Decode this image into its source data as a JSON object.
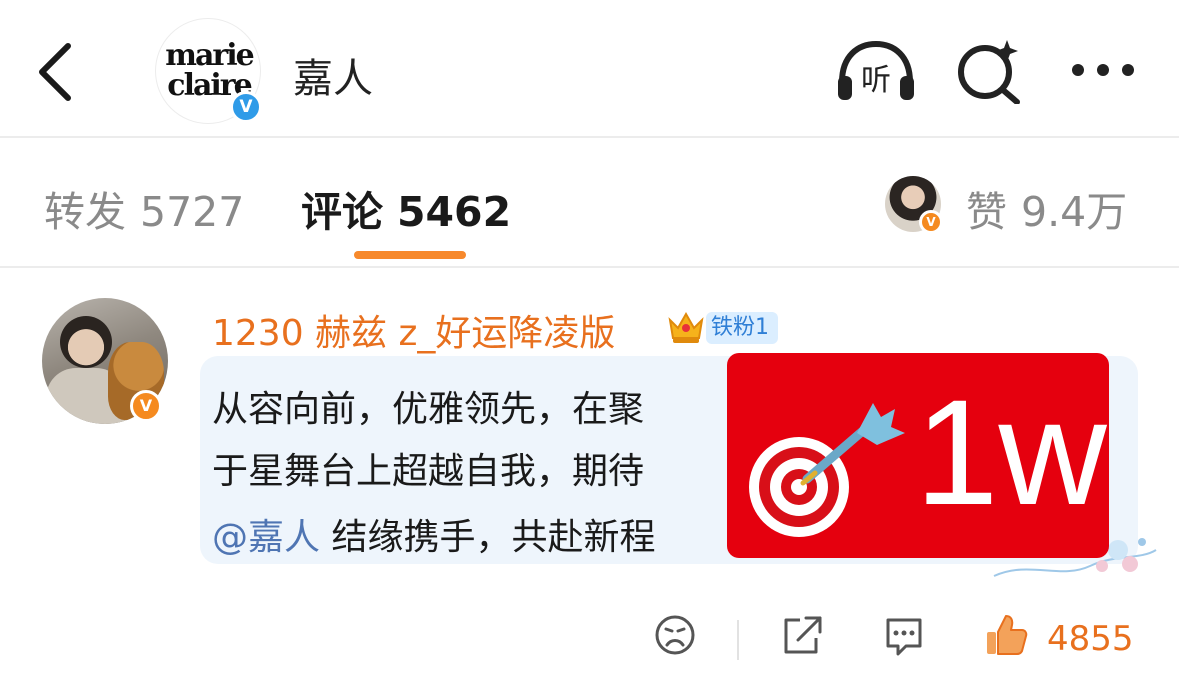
{
  "header": {
    "back_icon": "chevron-left-icon",
    "avatar_logo_line1": "marie",
    "avatar_logo_line2": "claire",
    "verified_mark": "V",
    "title": "嘉人",
    "listen_label": "听",
    "listen_icon": "headphones-icon",
    "search_icon": "search-sparkle-icon",
    "more_icon": "more-dots-icon"
  },
  "tabs": {
    "repost_label": "转发",
    "repost_count": "5727",
    "comment_label": "评论",
    "comment_count": "5462",
    "like_label": "赞",
    "like_count": "9.4万",
    "active": "comment",
    "accent": "#f7892c"
  },
  "comment": {
    "username": "1230 赫兹 z_好运降凌版",
    "fan_badge": "铁粉1",
    "user_badge": "V",
    "text_line1": "从容向前，优雅领先，在聚",
    "text_line2": "于星舞台上超越自我，期待",
    "mention": "@嘉人",
    "text_line3": " 结缘携手，共赴新程",
    "like_count": "4855"
  },
  "overlay": {
    "text": "1w",
    "color": "#e5000e",
    "icon": "bullseye-dart-icon"
  },
  "actions": {
    "dislike_icon": "frown-face-icon",
    "share_icon": "share-icon",
    "reply_icon": "comment-bubble-icon",
    "like_icon": "thumbs-up-icon",
    "like_color": "#e8701e"
  }
}
